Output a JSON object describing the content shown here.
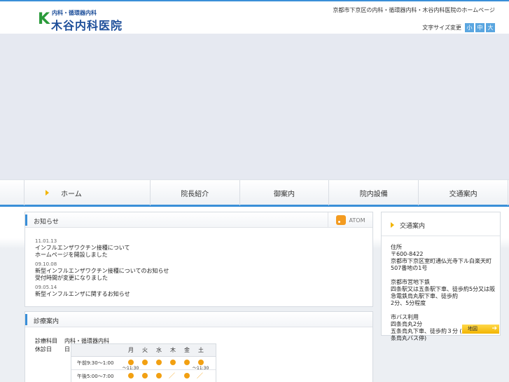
{
  "header": {
    "logo_mark": "K",
    "logo_subtitle": "内科・循環器内科",
    "logo_name": "木谷内科医院",
    "tagline": "京都市下京区の内科・循環器内科・木谷内科医院のホームページ",
    "font_size_label": "文字サイズ変更",
    "font_sizes": [
      "小",
      "中",
      "大"
    ]
  },
  "nav": {
    "items": [
      "ホーム",
      "院長紹介",
      "御案内",
      "院内設備",
      "交通案内"
    ]
  },
  "news": {
    "title": "お知らせ",
    "feed_label": "ATOM",
    "entries": [
      {
        "date": "11.01.13",
        "lines": [
          "インフルエンザワクチン接種について",
          "ホームページを開設しました"
        ]
      },
      {
        "date": "09.10.08",
        "lines": [
          "新型インフルエンザワクチン接種についてのお知らせ",
          "受付時間が変更になりました"
        ]
      },
      {
        "date": "09.05.14",
        "lines": [
          "新型インフルエンザに関するお知らせ"
        ]
      }
    ]
  },
  "hours": {
    "title": "診療案内",
    "rows": [
      {
        "label": "診療科目",
        "value": "内科・循環器内科"
      },
      {
        "label": "休診日",
        "value": "日"
      }
    ],
    "table": {
      "days": [
        "月",
        "火",
        "水",
        "木",
        "金",
        "土"
      ],
      "rows": [
        {
          "time": "午前9:30〜1:00",
          "cells": [
            "dot",
            "dot",
            "dot",
            "dot",
            "dot",
            "dot"
          ],
          "notes": [
            "〜11:30",
            "",
            "",
            "",
            "",
            "〜11:30"
          ]
        },
        {
          "time": "午後5:00〜7:00",
          "cells": [
            "dot",
            "dot",
            "dot",
            "slash",
            "dot",
            "slash"
          ],
          "notes": [
            "",
            "",
            "",
            "",
            "",
            ""
          ]
        }
      ]
    }
  },
  "access": {
    "title": "交通案内",
    "lines": [
      "住所",
      "〒600-8422",
      "京都市下京区室町通仏光寺下ル白楽天町507番地の1号",
      "",
      "京都市営地下鉄",
      "四条駅又は五条駅下車、徒歩約5分又は阪急電鉄烏丸駅下車、徒歩約",
      "2分、5分程度",
      "",
      "市バス利用",
      "四条烏丸2分",
      "五条烏丸下車、徒歩約３分 (四条烏丸・五条烏丸バス停)"
    ],
    "map_button": "地図"
  }
}
